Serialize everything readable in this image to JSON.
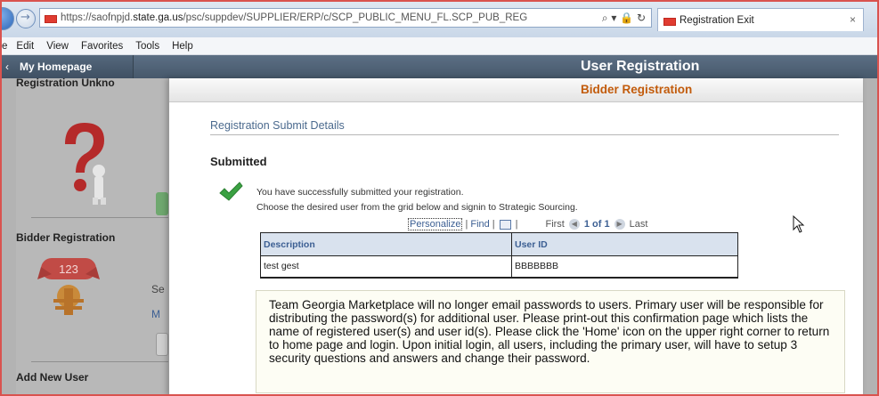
{
  "browser": {
    "url_prefix": "https://saofnpjd.",
    "url_domain": "state.ga.us",
    "url_suffix": "/psc/suppdev/SUPPLIER/ERP/c/SCP_PUBLIC_MENU_FL.SCP_PUB_REG",
    "addr_tools": "⌕ ▾ 🔒 ↻",
    "tab_title": "Registration Exit",
    "tab_close": "×",
    "menu": [
      "e",
      "Edit",
      "View",
      "Favorites",
      "Tools",
      "Help"
    ]
  },
  "header": {
    "home_chevron": "‹",
    "home_label": "My Homepage",
    "title": "User Registration"
  },
  "background": {
    "sec1_title": "Registration Unkno",
    "sec2_title": "Bidder Registration",
    "badge_number": "123",
    "stub_a": "Se",
    "stub_b": "M",
    "sec3_title": "Add New User"
  },
  "modal": {
    "title": "Bidder Registration",
    "section_heading": "Registration Submit Details",
    "status": "Submitted",
    "success_message": "You have successfully submitted your registration.",
    "instruction": "Choose the desired user from the grid below and signin to Strategic Sourcing.",
    "grid": {
      "personalize": "Personalize",
      "find": "Find",
      "first": "First",
      "page_of": "1 of 1",
      "last": "Last",
      "headers": [
        "Description",
        "User ID"
      ],
      "rows": [
        {
          "description": "test gest",
          "user_id": "BBBBBBB"
        }
      ]
    },
    "notice": "Team Georgia Marketplace will no longer email passwords to users. Primary user will be responsible for distributing the password(s) for additional user. Please print-out this confirmation page which lists the name of registered user(s) and user id(s). Please click the 'Home' icon on the upper right corner to return to home page and login. Upon initial login, all users, including the primary user, will have to setup 3 security questions and answers and change their password."
  },
  "colors": {
    "accent_orange": "#c25b0b",
    "link_blue": "#3c5f93",
    "success_green": "#3aa142"
  }
}
